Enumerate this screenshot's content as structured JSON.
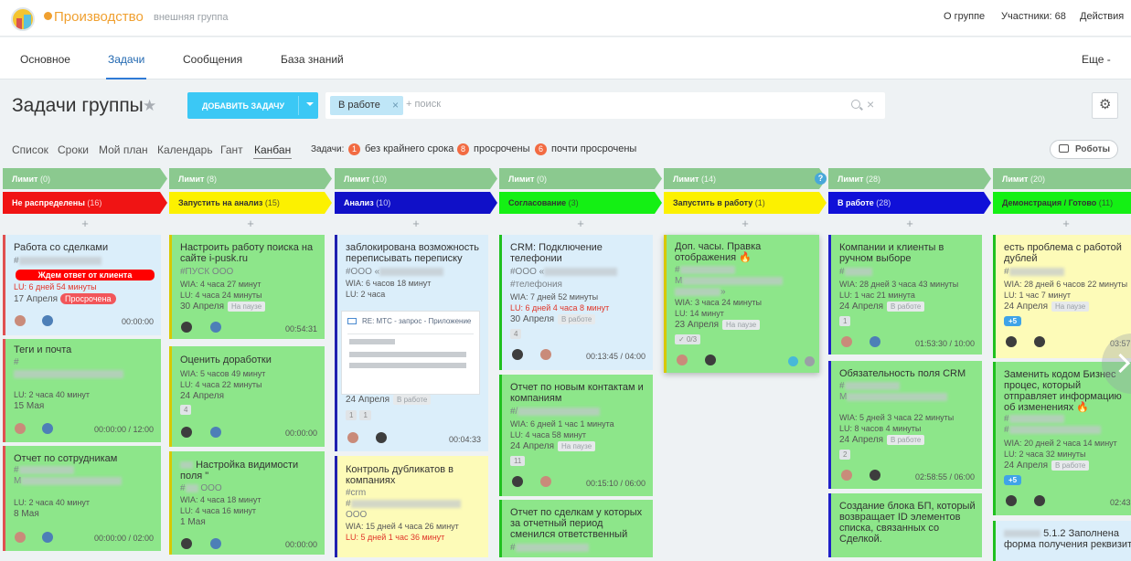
{
  "header": {
    "group_name": "Производство",
    "group_type": "внешняя группа",
    "about": "О группе",
    "members": "Участники: 68",
    "actions": "Действия"
  },
  "nav": {
    "tabs": [
      "Основное",
      "Задачи",
      "Сообщения",
      "База знаний"
    ],
    "more": "Еще -"
  },
  "page": {
    "title": "Задачи группы",
    "add_task": "ДОБАВИТЬ ЗАДАЧУ",
    "filter_chip": "В работе",
    "search_placeholder": "+ поиск"
  },
  "views": {
    "items": [
      "Список",
      "Сроки",
      "Мой план",
      "Календарь",
      "Гант",
      "Канбан"
    ],
    "tasks_label": "Задачи:",
    "no_deadline_count": "1",
    "no_deadline": "без крайнего срока",
    "overdue_count": "8",
    "overdue": "просрочены",
    "almost_count": "6",
    "almost": "почти просрочены",
    "robots": "Роботы"
  },
  "columns": [
    {
      "limit": "Лимит",
      "limit_n": "(0)",
      "stage": "Не распределены",
      "count": "(16)",
      "color": "#f01414",
      "text": "#ffffff"
    },
    {
      "limit": "Лимит",
      "limit_n": "(8)",
      "stage": "Запустить на анализ",
      "count": "(15)",
      "color": "#fcf100",
      "text": "#333333"
    },
    {
      "limit": "Лимит",
      "limit_n": "(10)",
      "stage": "Анализ",
      "count": "(10)",
      "color": "#1010c8",
      "text": "#ffffff"
    },
    {
      "limit": "Лимит",
      "limit_n": "(0)",
      "stage": "Согласование",
      "count": "(3)",
      "color": "#14f014",
      "text": "#333333"
    },
    {
      "limit": "Лимит",
      "limit_n": "(14)",
      "stage": "Запустить в работу",
      "count": "(1)",
      "color": "#fcf100",
      "text": "#333333"
    },
    {
      "limit": "Лимит",
      "limit_n": "(28)",
      "stage": "В работе",
      "count": "(28)",
      "color": "#1010d8",
      "text": "#ffffff"
    },
    {
      "limit": "Лимит",
      "limit_n": "(20)",
      "stage": "Демонстрация / Готово",
      "count": "(11)",
      "color": "#14f014",
      "text": "#333333"
    }
  ],
  "cards": {
    "c1": {
      "title": "Работа со сделками",
      "tag": "#",
      "wait": "Ждем ответ от клиента",
      "lu": "LU: 6 дней 54 минуты",
      "date": "17 Апреля",
      "over": "Просрочена",
      "time": "00:00:00"
    },
    "c2": {
      "title": "Теги и почта",
      "tag": "#",
      "lu": "LU: 2 часа 40 минут",
      "date": "15 Мая",
      "time": "00:00:00 / 12:00"
    },
    "c3": {
      "title": "Отчет по сотрудникам",
      "tag": "#",
      "m": "M",
      "lu": "LU: 2 часа 40 минут",
      "date": "8 Мая",
      "time": "00:00:00 / 02:00"
    },
    "c4": {
      "title": "Настроить работу поиска на сайте i-pusk.ru",
      "tag": "#ПУСК ООО",
      "wia": "WIA: 4 часа 27 минут",
      "lu": "LU: 4 часа 24 минуты",
      "date": "30 Апреля",
      "status": "На паузе",
      "time": "00:54:31"
    },
    "c5": {
      "title": "Оценить доработки",
      "wia": "WIA: 5 часов 49 минут",
      "lu": "LU: 4 часа 22 минуты",
      "date": "24 Апреля",
      "sub": "4",
      "time": "00:00:00"
    },
    "c6": {
      "title": "Настройка видимости поля \"",
      "tag": "#",
      "ooo": "ООО",
      "wia": "WIA: 4 часа 18 минут",
      "lu": "LU: 4 часа 16 минут",
      "date": "1 Мая",
      "time": "00:00:00"
    },
    "c7": {
      "title": "заблокирована возможность переписывать переписку",
      "tag": "#ООО «",
      "wia": "WIA: 6 часов 18 минут",
      "lu": "LU: 2 часа",
      "mail": "RE: МТС - запрос - Приложение",
      "date": "24 Апреля",
      "status": "В работе",
      "c1": "1",
      "c2": "1",
      "time": "00:04:33"
    },
    "c8": {
      "title": "Контроль дубликатов в компаниях",
      "tag": "#crm",
      "tag2": "#",
      "ooo": "ООО",
      "wia": "WIA: 15 дней 4 часа 26 минут",
      "lu": "LU: 5 дней 1 час 36 минут"
    },
    "c9": {
      "title": "CRM: Подключение телефонии",
      "tag": "#ООО «",
      "tag2": "#телефония",
      "wia": "WIA: 7 дней 52 минуты",
      "lu": "LU: 6 дней 4 часа 8 минут",
      "date": "30 Апреля",
      "status": "В работе",
      "sub": "4",
      "time": "00:13:45 / 04:00"
    },
    "c10": {
      "title": "Отчет по новым контактам и компаниям",
      "tag": "#/",
      "wia": "WIA: 6 дней 1 час 1 минута",
      "lu": "LU: 4 часа 58 минут",
      "date": "24 Апреля",
      "status": "На паузе",
      "sub": "11",
      "time": "00:15:10 / 06:00"
    },
    "c11": {
      "title": "Отчет по сделкам у которых за отчетный период сменился ответственный",
      "tag": "#"
    },
    "c12": {
      "title": "Доп. часы. Правка отображения",
      "tag": "#",
      "m": "M",
      "close": "»",
      "wia": "WIA: 3 часа 24 минуты",
      "lu": "LU: 14 минут",
      "date": "23 Апреля",
      "status": "На паузе",
      "check": "0/3"
    },
    "c13": {
      "title": "Компании и клиенты в ручном выборе",
      "tag": "#",
      "wia": "WIA: 28 дней 3 часа 43 минуты",
      "lu": "LU: 1 час 21 минута",
      "date": "24 Апреля",
      "status": "В работе",
      "sub": "1",
      "time": "01:53:30 / 10:00"
    },
    "c14": {
      "title": "Обязательность поля CRM",
      "tag": "#",
      "m": "M",
      "wia": "WIA: 5 дней 3 часа 22 минуты",
      "lu": "LU: 8 часов 4 минуты",
      "date": "24 Апреля",
      "status": "В работе",
      "sub": "2",
      "time": "02:58:55 / 06:00"
    },
    "c15": {
      "title": "Создание блока БП, который возвращает ID элементов списка, связанных со Сделкой."
    },
    "c16": {
      "title": "есть проблема с работой дублей",
      "tag": "#",
      "wia": "WIA: 28 дней 6 часов 22 минуты",
      "lu": "LU: 1 час 7 минут",
      "date": "24 Апреля",
      "status": "На паузе",
      "plus": "+5",
      "time": "03:57:"
    },
    "c17": {
      "title": "Заменить кодом Бизнес процес, который отправляет информацию об изменениях",
      "tag": "#",
      "tag2": "#",
      "wia": "WIA: 20 дней 2 часа 14 минут",
      "lu": "LU: 2 часа 32 минуты",
      "date": "24 Апреля",
      "status": "В работе",
      "plus": "+5",
      "time": "02:43:"
    },
    "c18": {
      "title": "5.1.2 Заполнена форма получения реквизит"
    }
  }
}
